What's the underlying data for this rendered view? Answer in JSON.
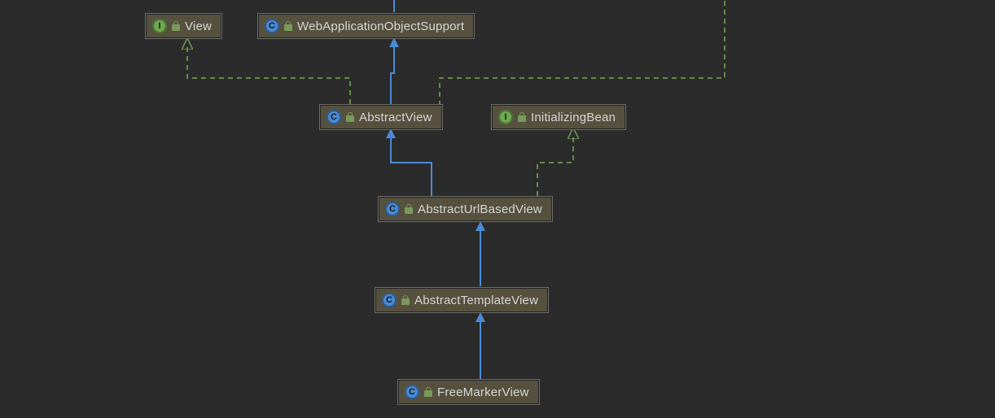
{
  "diagram": {
    "nodes": {
      "view": {
        "kind": "interface",
        "label": "View"
      },
      "webAppObjSupport": {
        "kind": "class",
        "label": "WebApplicationObjectSupport"
      },
      "abstractView": {
        "kind": "class",
        "label": "AbstractView"
      },
      "initializingBean": {
        "kind": "interface",
        "label": "InitializingBean"
      },
      "abstractUrlBasedView": {
        "kind": "class",
        "label": "AbstractUrlBasedView"
      },
      "abstractTemplateView": {
        "kind": "class",
        "label": "AbstractTemplateView"
      },
      "freeMarkerView": {
        "kind": "class",
        "label": "FreeMarkerView"
      }
    },
    "badgeGlyph": {
      "class": "C",
      "interface": "I"
    },
    "colors": {
      "inheritanceLine": "#4a8bd6",
      "implementsLine": "#6a9a4a",
      "nodeBg": "#55513e",
      "canvasBg": "#2b2b2b"
    },
    "edges": [
      {
        "from": "abstractView",
        "to": "view",
        "type": "implements"
      },
      {
        "from": "abstractView",
        "to": "webAppObjSupport",
        "type": "extends"
      },
      {
        "from": "abstractUrlBasedView",
        "to": "abstractView",
        "type": "extends"
      },
      {
        "from": "abstractUrlBasedView",
        "to": "initializingBean",
        "type": "implements"
      },
      {
        "from": "abstractTemplateView",
        "to": "abstractUrlBasedView",
        "type": "extends"
      },
      {
        "from": "freeMarkerView",
        "to": "abstractTemplateView",
        "type": "extends"
      }
    ]
  }
}
